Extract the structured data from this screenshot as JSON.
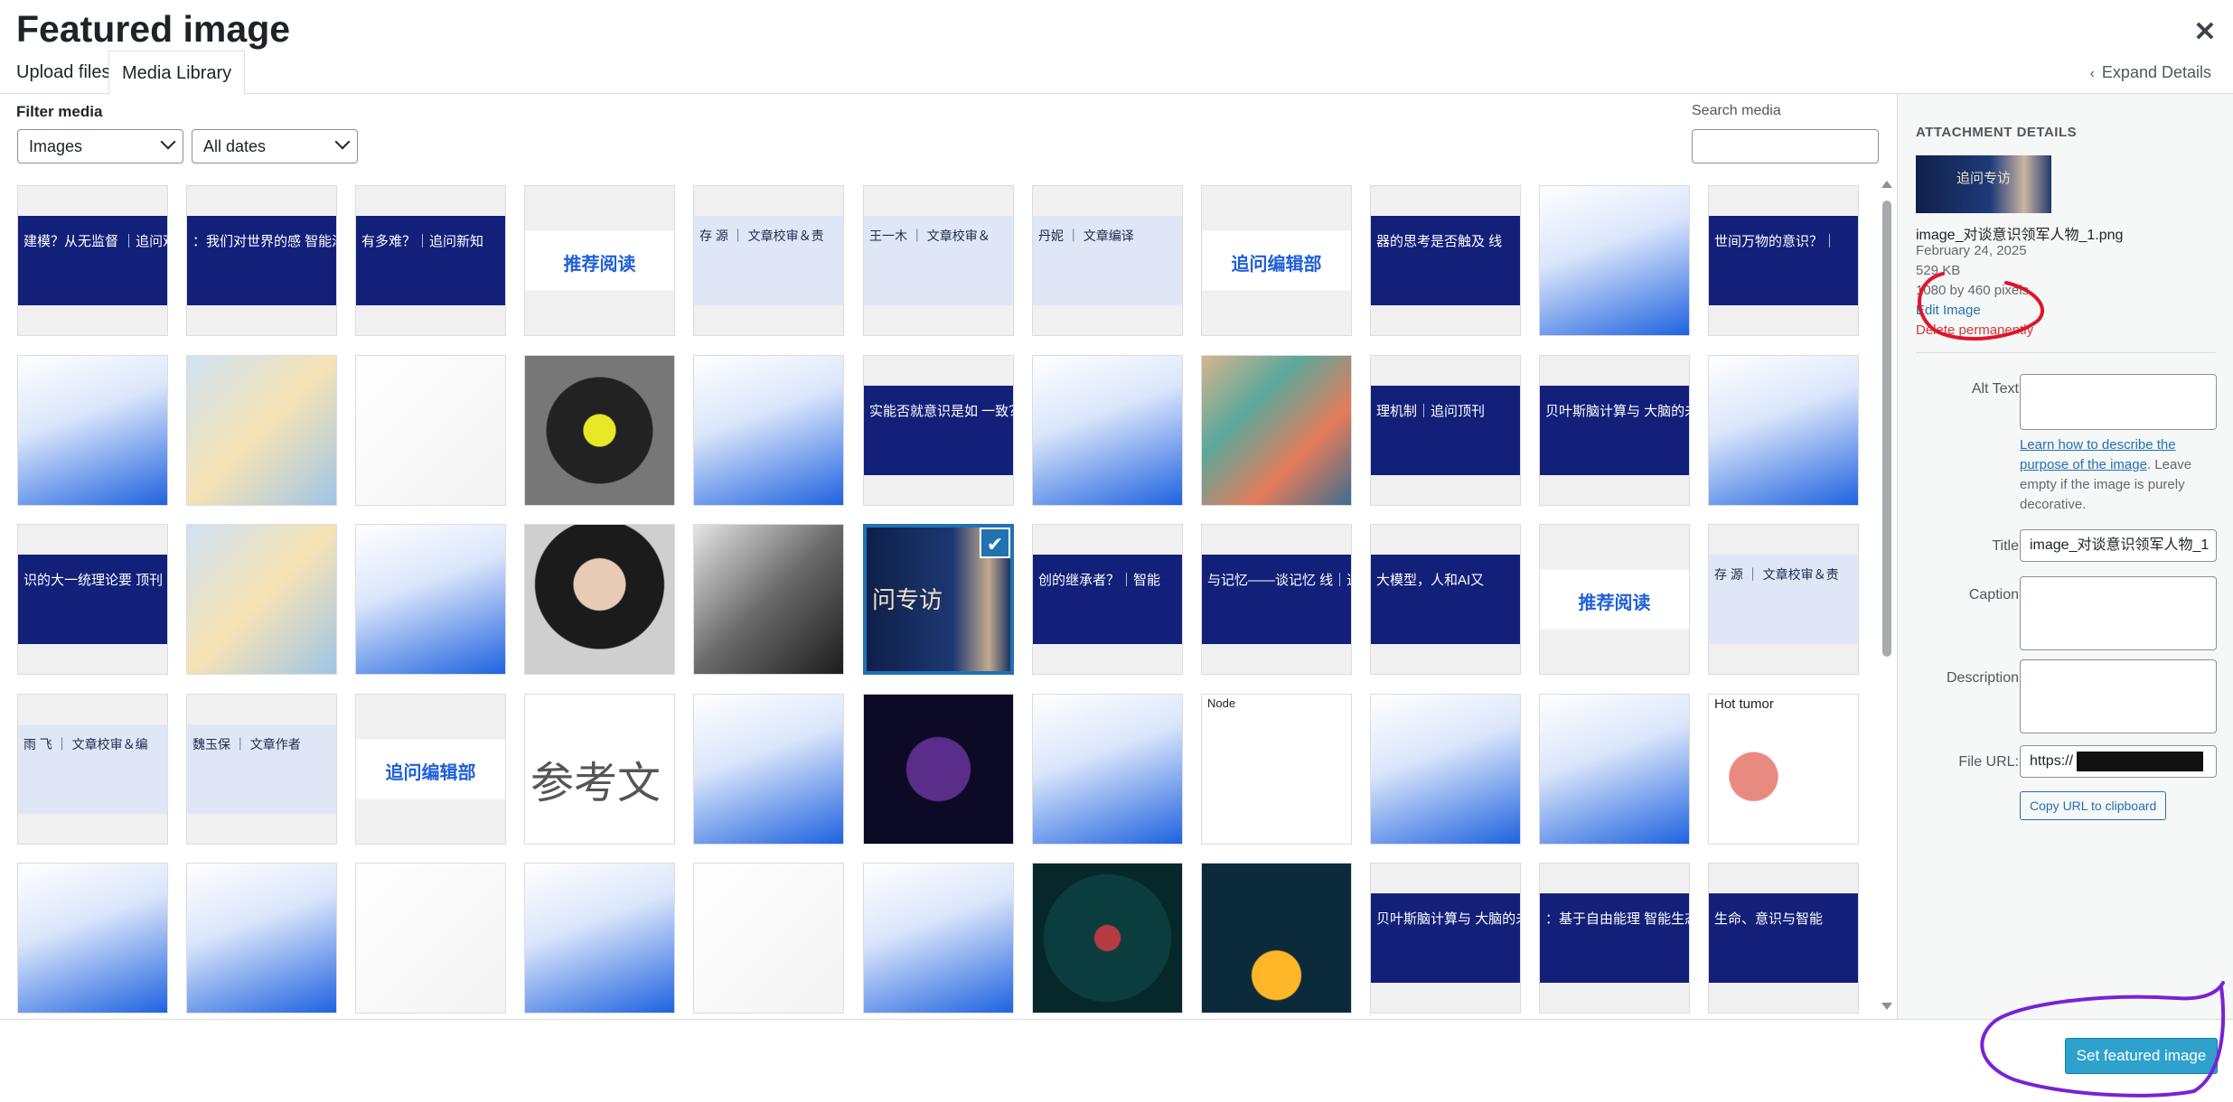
{
  "modal": {
    "title": "Featured image",
    "close_icon": "close-icon"
  },
  "tabs": {
    "upload": "Upload files",
    "library": "Media Library",
    "expand": "Expand Details"
  },
  "filters": {
    "label": "Filter media",
    "type_selected": "Images",
    "date_selected": "All dates",
    "search_label": "Search media",
    "search_value": ""
  },
  "grid": {
    "rows": [
      [
        {
          "text": "建模？从无监督 ｜追问观察",
          "style": "navy"
        },
        {
          "text": "：我们对世界的感 智能渐近线",
          "style": "navy"
        },
        {
          "text": "有多难？｜追问新知",
          "style": "navy"
        },
        {
          "text": "推荐阅读",
          "style": "badge"
        },
        {
          "text": "存 源 ｜ 文章校审＆责",
          "style": "light"
        },
        {
          "text": "王一木 ｜ 文章校审＆",
          "style": "light"
        },
        {
          "text": "丹妮 ｜ 文章编译",
          "style": "light"
        },
        {
          "text": "追问编辑部",
          "style": "badge"
        },
        {
          "text": "器的思考是否触及 线",
          "style": "navy"
        },
        {
          "text": "",
          "style": "logo"
        },
        {
          "text": "世间万物的意识？｜",
          "style": "navy"
        }
      ],
      [
        {
          "text": "",
          "style": "logo"
        },
        {
          "text": "",
          "style": "comic"
        },
        {
          "text": "",
          "style": "diagram"
        },
        {
          "text": "",
          "style": "abstract"
        },
        {
          "text": "",
          "style": "logo"
        },
        {
          "text": "实能否就意识是如 一致？｜追问观察",
          "style": "navy"
        },
        {
          "text": "",
          "style": "logo"
        },
        {
          "text": "",
          "style": "collage"
        },
        {
          "text": "理机制｜追问顶刊",
          "style": "navy"
        },
        {
          "text": "贝叶斯脑计算与 大脑的未来吗？",
          "style": "navy"
        },
        {
          "text": "",
          "style": "logo"
        }
      ],
      [
        {
          "text": "识的大一统理论要 顶刊",
          "style": "navy"
        },
        {
          "text": "",
          "style": "comic"
        },
        {
          "text": "",
          "style": "logo"
        },
        {
          "text": "",
          "style": "portrait"
        },
        {
          "text": "",
          "style": "bw-portrait"
        },
        {
          "text": "问专访",
          "style": "selected"
        },
        {
          "text": "创的继承者？｜智能",
          "style": "navy"
        },
        {
          "text": "与记忆——谈记忆 线｜追问观察",
          "style": "navy"
        },
        {
          "text": "大模型，人和AI又",
          "style": "navy"
        },
        {
          "text": "推荐阅读",
          "style": "badge"
        },
        {
          "text": "存 源 ｜ 文章校审＆责",
          "style": "light"
        }
      ],
      [
        {
          "text": "雨 飞 ｜ 文章校审＆编",
          "style": "light"
        },
        {
          "text": "魏玉保 ｜ 文章作者",
          "style": "light"
        },
        {
          "text": "追问编辑部",
          "style": "badge"
        },
        {
          "text": "参考文",
          "style": "bigtext"
        },
        {
          "text": "",
          "style": "logo"
        },
        {
          "text": "",
          "style": "cells"
        },
        {
          "text": "",
          "style": "logo"
        },
        {
          "text": "Node",
          "style": "graph"
        },
        {
          "text": "",
          "style": "logo"
        },
        {
          "text": "",
          "style": "logo"
        },
        {
          "text": "Hot tumor",
          "style": "tumor"
        }
      ],
      [
        {
          "text": "",
          "style": "logo"
        },
        {
          "text": "",
          "style": "logo"
        },
        {
          "text": "",
          "style": "diagram"
        },
        {
          "text": "",
          "style": "logo"
        },
        {
          "text": "",
          "style": "diagram"
        },
        {
          "text": "",
          "style": "logo"
        },
        {
          "text": "",
          "style": "cell-dark"
        },
        {
          "text": "",
          "style": "golden"
        },
        {
          "text": "贝叶斯脑计算与 大脑的未来吗？",
          "style": "navy"
        },
        {
          "text": "：基于自由能理 智能生态系统",
          "style": "navy"
        },
        {
          "text": "生命、意识与智能",
          "style": "navy"
        }
      ]
    ]
  },
  "details": {
    "heading": "ATTACHMENT DETAILS",
    "thumb_text": "追问专访",
    "filename": "image_对谈意识领军人物_1.png",
    "date": "February 24, 2025",
    "size": "529 KB",
    "dimensions": "1080 by 460 pixels",
    "edit_link": "Edit Image",
    "delete_link": "Delete permanently",
    "alt_label": "Alt Text",
    "alt_help_link": "Learn how to describe the purpose of the image",
    "alt_help_rest": ". Leave empty if the image is purely decorative.",
    "title_label": "Title",
    "title_value": "image_对谈意识领军人物_1",
    "caption_label": "Caption",
    "description_label": "Description",
    "url_label": "File URL:",
    "url_value": "https://",
    "copy_button": "Copy URL to clipboard"
  },
  "footer": {
    "primary_button": "Set featured image"
  },
  "colors": {
    "accent": "#2271b1",
    "primary": "#2ea2cc",
    "annotation_red": "#e0142b",
    "annotation_purple": "#7a22d6"
  }
}
